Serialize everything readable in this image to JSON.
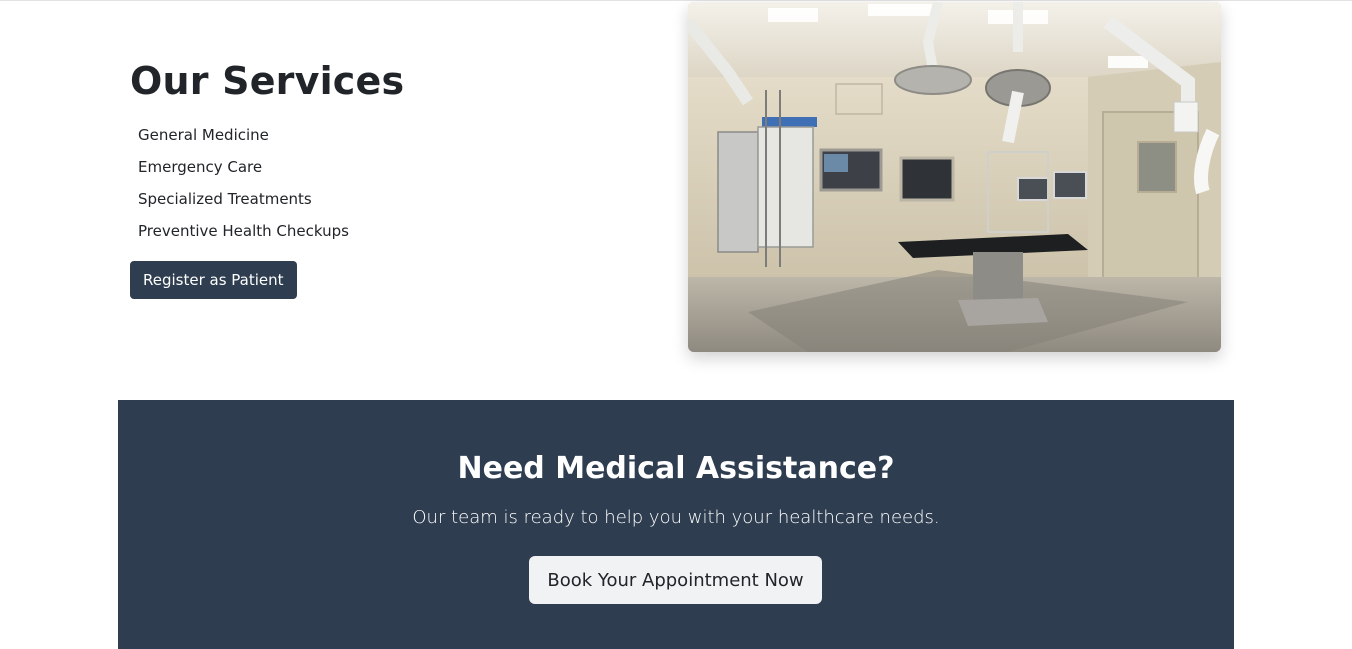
{
  "services": {
    "title": "Our Services",
    "items": [
      "General Medicine",
      "Emergency Care",
      "Specialized Treatments",
      "Preventive Health Checkups"
    ],
    "register_label": "Register as Patient",
    "image_subject": "operating-room-photo"
  },
  "cta": {
    "title": "Need Medical Assistance?",
    "subtitle": "Our team is ready to help you with your healthcare needs.",
    "button_label": "Book Your Appointment Now"
  },
  "colors": {
    "primary": "#2e3d50",
    "cta_button_bg": "#f0f2f4",
    "text": "#212529"
  }
}
